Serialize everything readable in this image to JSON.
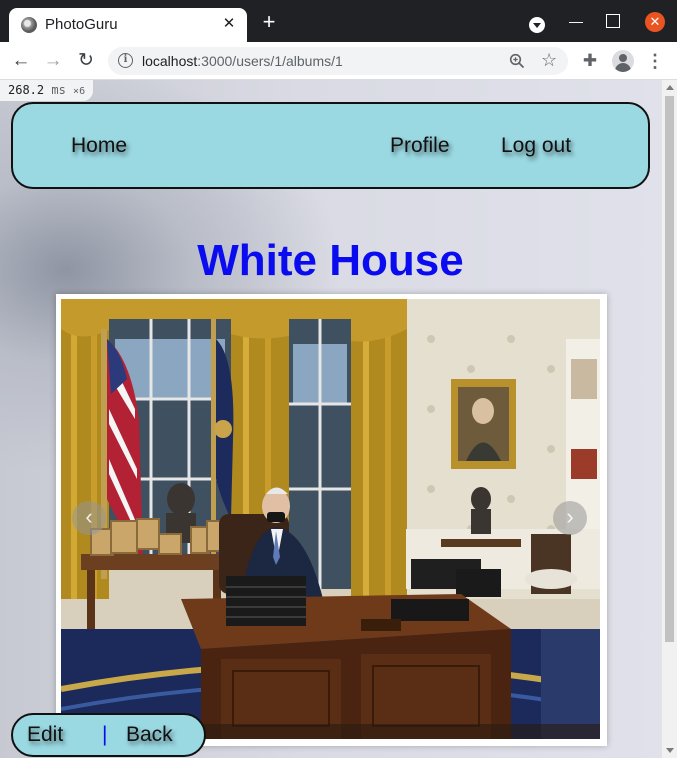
{
  "browser": {
    "tab_title": "PhotoGuru",
    "url_host": "localhost",
    "url_path": ":3000/users/1/albums/1"
  },
  "perf_overlay": {
    "value": "268.2",
    "unit": "ms",
    "multiplier": "×6"
  },
  "navbar": {
    "home": "Home",
    "profile": "Profile",
    "logout": "Log out"
  },
  "album": {
    "title": "White House"
  },
  "carousel": {
    "prev_glyph": "‹",
    "next_glyph": "›"
  },
  "footer": {
    "edit": "Edit",
    "separator": "|",
    "back": "Back"
  },
  "colors": {
    "nav_background": "#9ad8e2",
    "title_color": "#0b0bf0",
    "separator_color": "#0b0bf0"
  }
}
